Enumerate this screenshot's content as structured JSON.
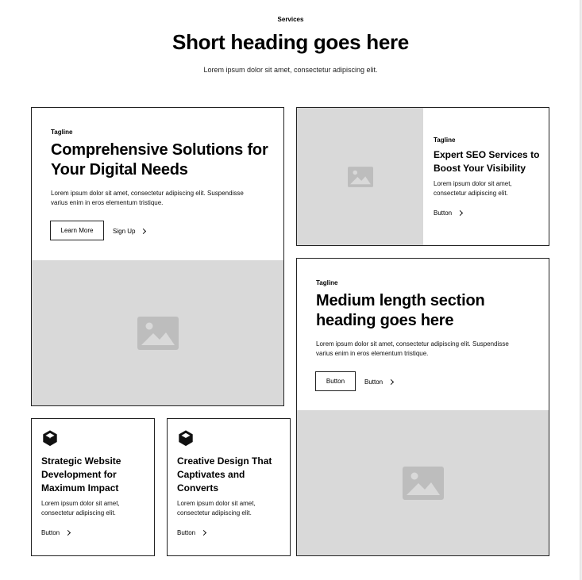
{
  "header": {
    "eyebrow": "Services",
    "heading": "Short heading goes here",
    "subheading": "Lorem ipsum dolor sit amet, consectetur adipiscing elit."
  },
  "card_main": {
    "tagline": "Tagline",
    "heading": "Comprehensive Solutions for Your Digital Needs",
    "body": "Lorem ipsum dolor sit amet, consectetur adipiscing elit. Suspendisse varius enim in eros elementum tristique.",
    "primary_button": "Learn More",
    "secondary_button": "Sign Up"
  },
  "card_seo": {
    "tagline": "Tagline",
    "heading": "Expert SEO Services to Boost Your Visibility",
    "body": "Lorem ipsum dolor sit amet, consectetur adipiscing elit.",
    "button": "Button"
  },
  "card_medium": {
    "tagline": "Tagline",
    "heading": "Medium length section heading goes here",
    "body": "Lorem ipsum dolor sit amet, consectetur adipiscing elit. Suspendisse varius enim in eros elementum tristique.",
    "primary_button": "Button",
    "secondary_button": "Button"
  },
  "card_strategic": {
    "icon": "cube-icon",
    "heading": "Strategic Website Development for Maximum Impact",
    "body": "Lorem ipsum dolor sit amet, consectetur adipiscing elit.",
    "button": "Button"
  },
  "card_creative": {
    "icon": "cube-icon",
    "heading": "Creative Design That Captivates and Converts",
    "body": "Lorem ipsum dolor sit amet, consectetur adipiscing elit.",
    "button": "Button"
  },
  "colors": {
    "placeholder_bg": "#d9d9d9",
    "placeholder_icon": "#bdbdbd",
    "border": "#222222"
  }
}
